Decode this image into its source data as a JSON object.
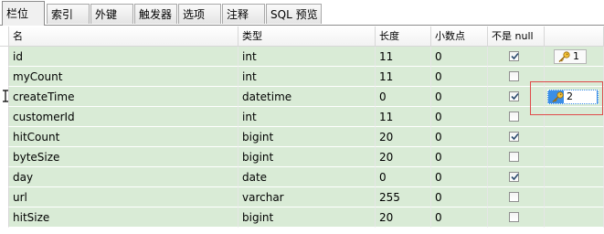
{
  "tabs": [
    {
      "label": "栏位"
    },
    {
      "label": "索引"
    },
    {
      "label": "外键"
    },
    {
      "label": "触发器"
    },
    {
      "label": "选项"
    },
    {
      "label": "注释"
    },
    {
      "label": "SQL 预览"
    }
  ],
  "columns": {
    "name": "名",
    "type": "类型",
    "length": "长度",
    "decimals": "小数点",
    "not_null": "不是 null",
    "key": ""
  },
  "rows": [
    {
      "name": "id",
      "type": "int",
      "length": "11",
      "decimals": "0",
      "not_null": true,
      "key": "1"
    },
    {
      "name": "myCount",
      "type": "int",
      "length": "11",
      "decimals": "0",
      "not_null": false,
      "key": ""
    },
    {
      "name": "createTime",
      "type": "datetime",
      "length": "0",
      "decimals": "0",
      "not_null": true,
      "key": "2"
    },
    {
      "name": "customerId",
      "type": "int",
      "length": "11",
      "decimals": "0",
      "not_null": false,
      "key": ""
    },
    {
      "name": "hitCount",
      "type": "bigint",
      "length": "20",
      "decimals": "0",
      "not_null": true,
      "key": ""
    },
    {
      "name": "byteSize",
      "type": "bigint",
      "length": "20",
      "decimals": "0",
      "not_null": false,
      "key": ""
    },
    {
      "name": "day",
      "type": "date",
      "length": "0",
      "decimals": "0",
      "not_null": true,
      "key": ""
    },
    {
      "name": "url",
      "type": "varchar",
      "length": "255",
      "decimals": "0",
      "not_null": false,
      "key": ""
    },
    {
      "name": "hitSize",
      "type": "bigint",
      "length": "20",
      "decimals": "0",
      "not_null": false,
      "key": ""
    }
  ],
  "icons": {
    "key": "key-icon",
    "checkbox": "checkbox-icon",
    "cursor": "text-cursor-icon"
  },
  "colors": {
    "row_bg": "#d9ebd6",
    "selection": "#3a8ee6",
    "highlight_box": "#e04a4a"
  }
}
